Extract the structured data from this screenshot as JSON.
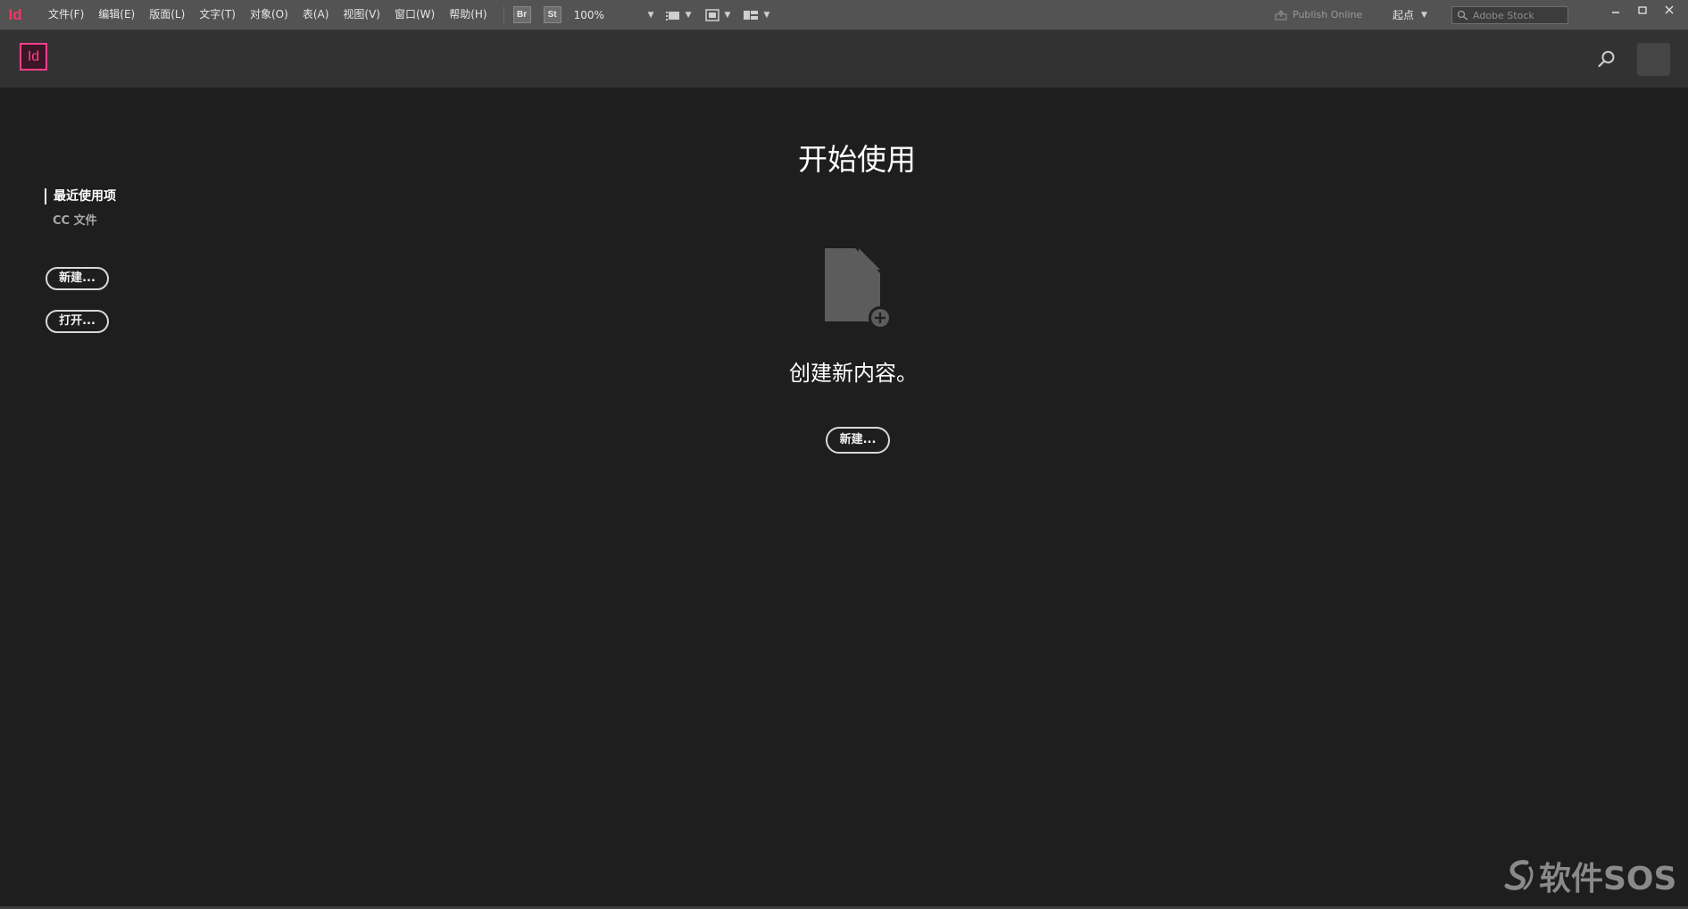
{
  "menubar": {
    "app_glyph": "Id",
    "menus": [
      "文件(F)",
      "编辑(E)",
      "版面(L)",
      "文字(T)",
      "对象(O)",
      "表(A)",
      "视图(V)",
      "窗口(W)",
      "帮助(H)"
    ],
    "bridge_label": "Br",
    "stock_label": "St",
    "zoom_value": "100%",
    "publish_online": "Publish Online",
    "workspace": "起点",
    "stock_search_placeholder": "Adobe Stock"
  },
  "header": {
    "logo_text": "Id"
  },
  "sidebar": {
    "recent": "最近使用项",
    "cc_files": "CC 文件",
    "new_button": "新建...",
    "open_button": "打开..."
  },
  "main": {
    "title": "开始使用",
    "create_text": "创建新内容。",
    "new_button": "新建..."
  },
  "watermark": {
    "text": "软件SOS"
  },
  "colors": {
    "background": "#1e1e1e",
    "menubar": "#535353",
    "header": "#323232",
    "indesign_pink": "#ff3f8b"
  }
}
